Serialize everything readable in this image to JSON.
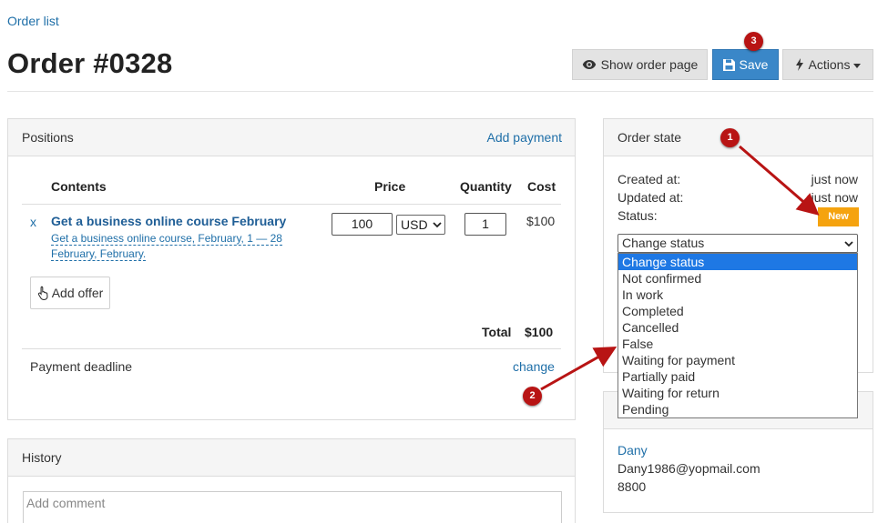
{
  "breadcrumb": "Order list",
  "title": "Order #0328",
  "toolbar": {
    "show_order_page": "Show order page",
    "save": "Save",
    "actions": "Actions"
  },
  "positions": {
    "title": "Positions",
    "add_payment": "Add payment",
    "columns": {
      "contents": "Contents",
      "price": "Price",
      "quantity": "Quantity",
      "cost": "Cost"
    },
    "item": {
      "remove": "x",
      "name": "Get a business online course February",
      "description": "Get a business online course, February, 1 — 28 February, February.",
      "price": "100",
      "currency": "USD",
      "quantity": "1",
      "cost": "$100"
    },
    "add_offer": "Add offer",
    "total_label": "Total",
    "total_value": "$100",
    "payment_deadline": "Payment deadline",
    "change": "change"
  },
  "history": {
    "title": "History",
    "comment_placeholder": "Add comment"
  },
  "order_state": {
    "title": "Order state",
    "created_label": "Created at:",
    "created_value": "just now",
    "updated_label": "Updated at:",
    "updated_value": "just now",
    "status_label": "Status:",
    "status_badge": "New",
    "status_select": "Change status",
    "options": [
      "Change status",
      "Not confirmed",
      "In work",
      "Completed",
      "Cancelled",
      "False",
      "Waiting for payment",
      "Partially paid",
      "Waiting for return",
      "Pending"
    ]
  },
  "customer": {
    "name": "Dany",
    "email": "Dany1986@yopmail.com",
    "phone": "8800"
  },
  "annotations": {
    "marker1": "1",
    "marker2": "2",
    "marker3": "3"
  },
  "colors": {
    "accent": "#3a87c8",
    "link": "#1f6fa8",
    "badge": "#f5a30f",
    "marker": "#b81414",
    "selected_option": "#1e78e4"
  }
}
